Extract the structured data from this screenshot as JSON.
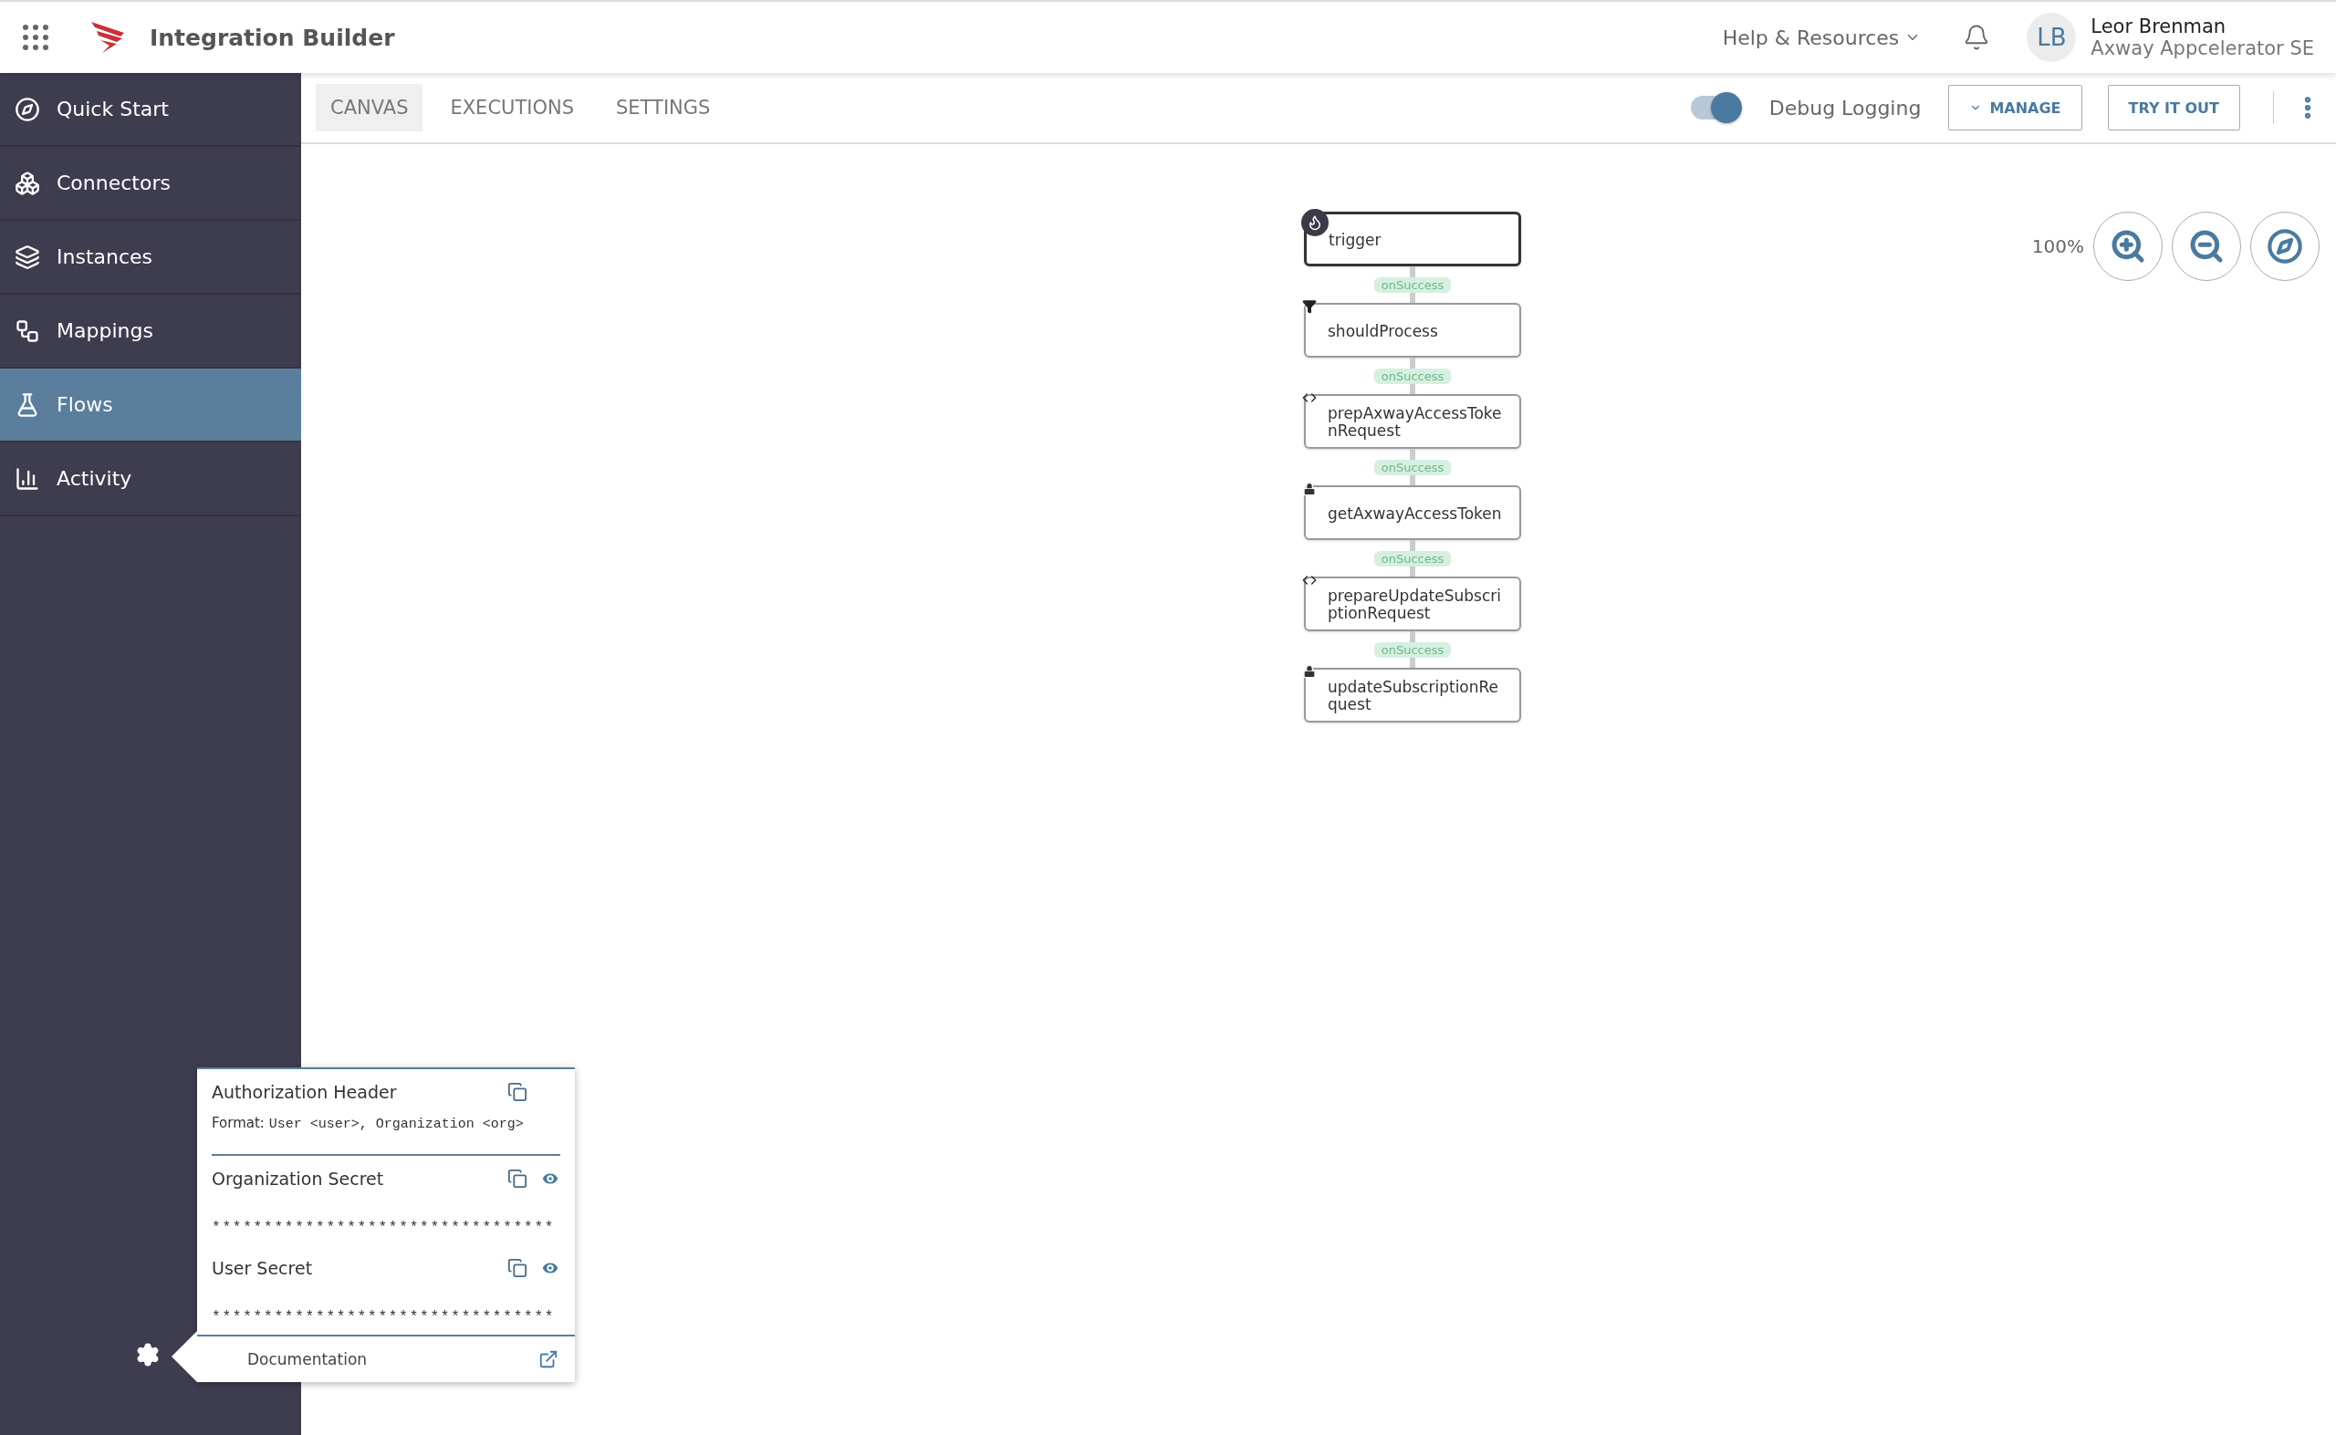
{
  "header": {
    "title": "Integration Builder",
    "help_menu": "Help & Resources",
    "user": {
      "initials": "LB",
      "name": "Leor Brenman",
      "organization": "Axway Appcelerator SE"
    }
  },
  "sidebar": {
    "items": [
      {
        "label": "Quick Start",
        "kind": "compass",
        "selected": false
      },
      {
        "label": "Connectors",
        "kind": "cubes",
        "selected": false
      },
      {
        "label": "Instances",
        "kind": "layers",
        "selected": false
      },
      {
        "label": "Mappings",
        "kind": "mapping",
        "selected": false
      },
      {
        "label": "Flows",
        "kind": "flask",
        "selected": true
      },
      {
        "label": "Activity",
        "kind": "chart",
        "selected": false
      }
    ]
  },
  "tabs": [
    {
      "label": "CANVAS",
      "selected": true
    },
    {
      "label": "EXECUTIONS",
      "selected": false
    },
    {
      "label": "SETTINGS",
      "selected": false
    }
  ],
  "toolbar": {
    "debug_logging": {
      "label": "Debug Logging",
      "on": true
    },
    "buttons": [
      "MANAGE",
      "TRY IT OUT"
    ]
  },
  "canvas": {
    "zoom": "100%",
    "nodes": [
      {
        "label": "trigger",
        "kind": "trigger"
      },
      {
        "label": "shouldProcess",
        "kind": "filter"
      },
      {
        "label": "prepAxwayAccessTokenRequest",
        "kind": "script"
      },
      {
        "label": "getAxwayAccessToken",
        "kind": "request"
      },
      {
        "label": "prepareUpdateSubscriptionRequest",
        "kind": "script"
      },
      {
        "label": "updateSubscriptionRequest",
        "kind": "request"
      }
    ],
    "edges": [
      "onSuccess",
      "onSuccess",
      "onSuccess",
      "onSuccess",
      "onSuccess"
    ]
  },
  "popup": {
    "authorization": {
      "title": "Authorization Header",
      "format_label": "Format:",
      "format_value": "User <user>, Organization <org>"
    },
    "secrets": [
      {
        "title": "Organization Secret",
        "value": "*********************************"
      },
      {
        "title": "User Secret",
        "value": "*********************************"
      }
    ],
    "link": "Documentation"
  }
}
